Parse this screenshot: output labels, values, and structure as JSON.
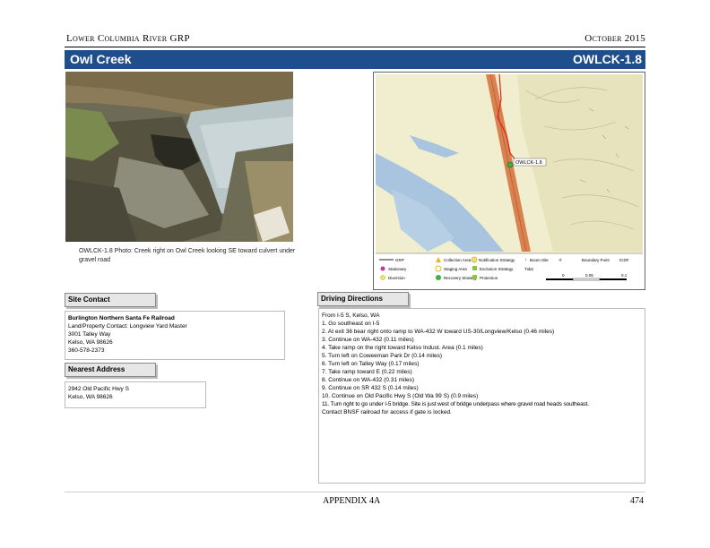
{
  "header": {
    "left": "Lower Columbia River GRP",
    "right": "October 2015"
  },
  "title": {
    "site_name": "Owl Creek",
    "site_code": "OWLCK-1.8"
  },
  "photo": {
    "caption": "OWLCK-1.8 Photo: Creek right on Owl Creek looking SE toward culvert under gravel road"
  },
  "map": {
    "site_label": "OWLCK-1.8",
    "legend": {
      "row1": [
        "GRP",
        "Collection Area",
        "Notification Strategy",
        "Boom Site",
        "Boundary Point",
        "ICDF"
      ],
      "row2": [
        "Stationary",
        "Staging Area",
        "Exclusion Strategy",
        "Tidal"
      ],
      "row3": [
        "Diversion",
        "Recovery Strategy",
        "Protection"
      ],
      "scale": [
        "0",
        "0.05",
        "0.1"
      ]
    }
  },
  "site_contact": {
    "label": "Site Contact",
    "lines": [
      "Burlington Northern Santa Fe Railroad",
      "Land/Property Contact: Longview Yard Master",
      "3001 Talley Way",
      "Kelso, WA 98626",
      "360-578-2373"
    ]
  },
  "nearest_address": {
    "label": "Nearest Address",
    "lines": [
      "2942 Old Pacific Hwy S",
      "Kelso, WA 98626"
    ]
  },
  "driving_directions": {
    "label": "Driving Directions",
    "lines": [
      "From I-5 S, Kelso, WA",
      "1. Go southeast on I-5",
      "2. At exit 36 bear right onto ramp to WA-432 W toward US-30/Longview/Kelso (0.46 miles)",
      "3. Continue on WA-432 (0.11 miles)",
      "4. Take ramp on the right toward Kelso Indust. Area (0.1 miles)",
      "5. Turn left on Coweeman Park Dr (0.14 miles)",
      "6. Turn left on Talley Way (0.17 miles)",
      "7. Take ramp toward E (0.22 miles)",
      "8. Continue on WA-432 (0.31 miles)",
      "9. Continue on SR 432 S (0.14 miles)",
      "10. Continue on Old Pacific Hwy S (Old Wa 99 S) (0.9 miles)",
      "11. Turn right to go under I-5 bridge. Site is just west of bridge underpass where gravel road heads southeast.",
      "Contact BNSF railroad for access if gate is locked."
    ]
  },
  "footer": {
    "center": "APPENDIX 4A",
    "page": "474"
  },
  "colors": {
    "title_bar": "#1f4e8c",
    "water": "#a8c4de",
    "land": "#f1eecf",
    "highway": "#d9824f",
    "hills": "#d4d2a6",
    "route": "#e02020"
  }
}
